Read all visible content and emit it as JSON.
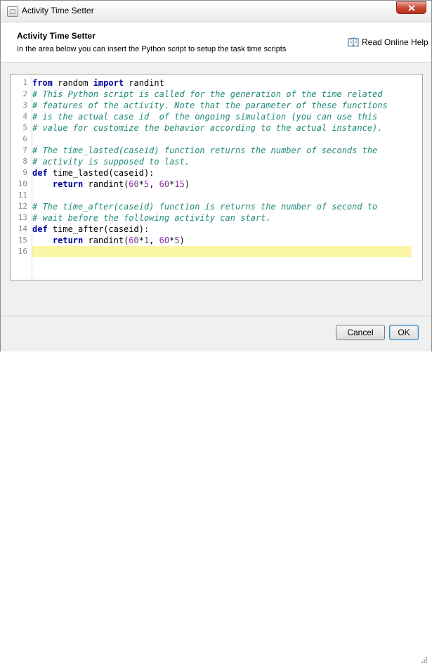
{
  "window": {
    "title": "Activity Time Setter"
  },
  "header": {
    "title": "Activity Time Setter",
    "subtitle": "In the area below you can insert the Python script to setup the task time scripts",
    "help_label": "Read Online Help",
    "help_icon": "book-icon"
  },
  "editor": {
    "language": "Python",
    "current_line": 16,
    "lines": [
      [
        {
          "t": "from",
          "c": "kw"
        },
        {
          "t": " random "
        },
        {
          "t": "import",
          "c": "kw"
        },
        {
          "t": " randint"
        }
      ],
      [
        {
          "t": "# This Python script is called for the generation of the time related",
          "c": "cm"
        }
      ],
      [
        {
          "t": "# features of the activity. Note that the parameter of these functions",
          "c": "cm"
        }
      ],
      [
        {
          "t": "# is the actual case id  of the ongoing simulation (you can use this",
          "c": "cm"
        }
      ],
      [
        {
          "t": "# value for customize the behavior according to the actual instance).",
          "c": "cm"
        }
      ],
      [],
      [
        {
          "t": "# The time_lasted(caseid) function returns the number of seconds the",
          "c": "cm"
        }
      ],
      [
        {
          "t": "# activity is supposed to last.",
          "c": "cm"
        }
      ],
      [
        {
          "t": "def",
          "c": "kw"
        },
        {
          "t": " time_lasted(caseid):"
        }
      ],
      [
        {
          "t": "    "
        },
        {
          "t": "return",
          "c": "kw"
        },
        {
          "t": " randint("
        },
        {
          "t": "60",
          "c": "num"
        },
        {
          "t": "*"
        },
        {
          "t": "5",
          "c": "num"
        },
        {
          "t": ", "
        },
        {
          "t": "60",
          "c": "num"
        },
        {
          "t": "*"
        },
        {
          "t": "15",
          "c": "num"
        },
        {
          "t": ")"
        }
      ],
      [],
      [
        {
          "t": "# The time_after(caseid) function is returns the number of second to",
          "c": "cm"
        }
      ],
      [
        {
          "t": "# wait before the following activity can start.",
          "c": "cm"
        }
      ],
      [
        {
          "t": "def",
          "c": "kw"
        },
        {
          "t": " time_after(caseid):"
        }
      ],
      [
        {
          "t": "    "
        },
        {
          "t": "return",
          "c": "kw"
        },
        {
          "t": " randint("
        },
        {
          "t": "60",
          "c": "num"
        },
        {
          "t": "*"
        },
        {
          "t": "1",
          "c": "num"
        },
        {
          "t": ", "
        },
        {
          "t": "60",
          "c": "num"
        },
        {
          "t": "*"
        },
        {
          "t": "5",
          "c": "num"
        },
        {
          "t": ")"
        }
      ],
      []
    ]
  },
  "footer": {
    "cancel_label": "Cancel",
    "ok_label": "OK"
  },
  "colors": {
    "keyword": "#00009c",
    "comment": "#1f8a7a",
    "number": "#8c2fa0",
    "current_line": "#fbf6a5",
    "close_button": "#c7442e"
  }
}
